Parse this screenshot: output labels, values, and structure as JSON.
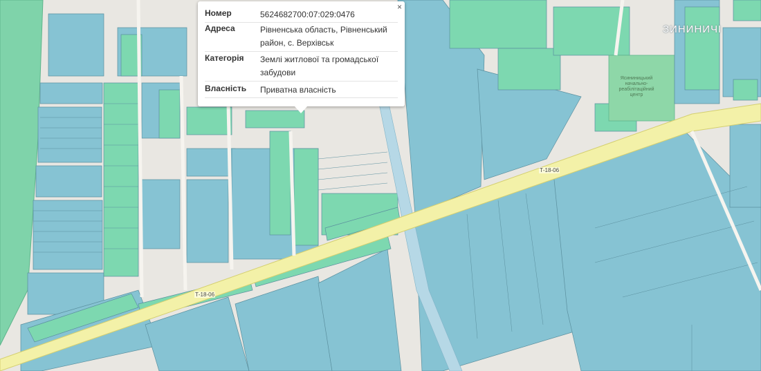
{
  "popup": {
    "close_label": "×",
    "rows": [
      {
        "label": "Номер",
        "value": "5624682700:07:029:0476"
      },
      {
        "label": "Адреса",
        "value": "Рівненська область, Рівненський район, с. Верхівськ"
      },
      {
        "label": "Категорія",
        "value": "Землі житлової та громадської забудови"
      },
      {
        "label": "Власність",
        "value": "Приватна власність"
      }
    ]
  },
  "map": {
    "village_label": "ЗИНИНИЧІ",
    "road_labels": [
      "Т-18-06",
      "Т-18-06"
    ],
    "park_label": "Ясининицький начально-реабілітаційний центр",
    "colors": {
      "background": "#e9e7e2",
      "parcel_blue": "#86c3d3",
      "parcel_green": "#7dd8b0",
      "road_fill": "#f3f1a8",
      "forest": "#7fd3aa"
    }
  }
}
